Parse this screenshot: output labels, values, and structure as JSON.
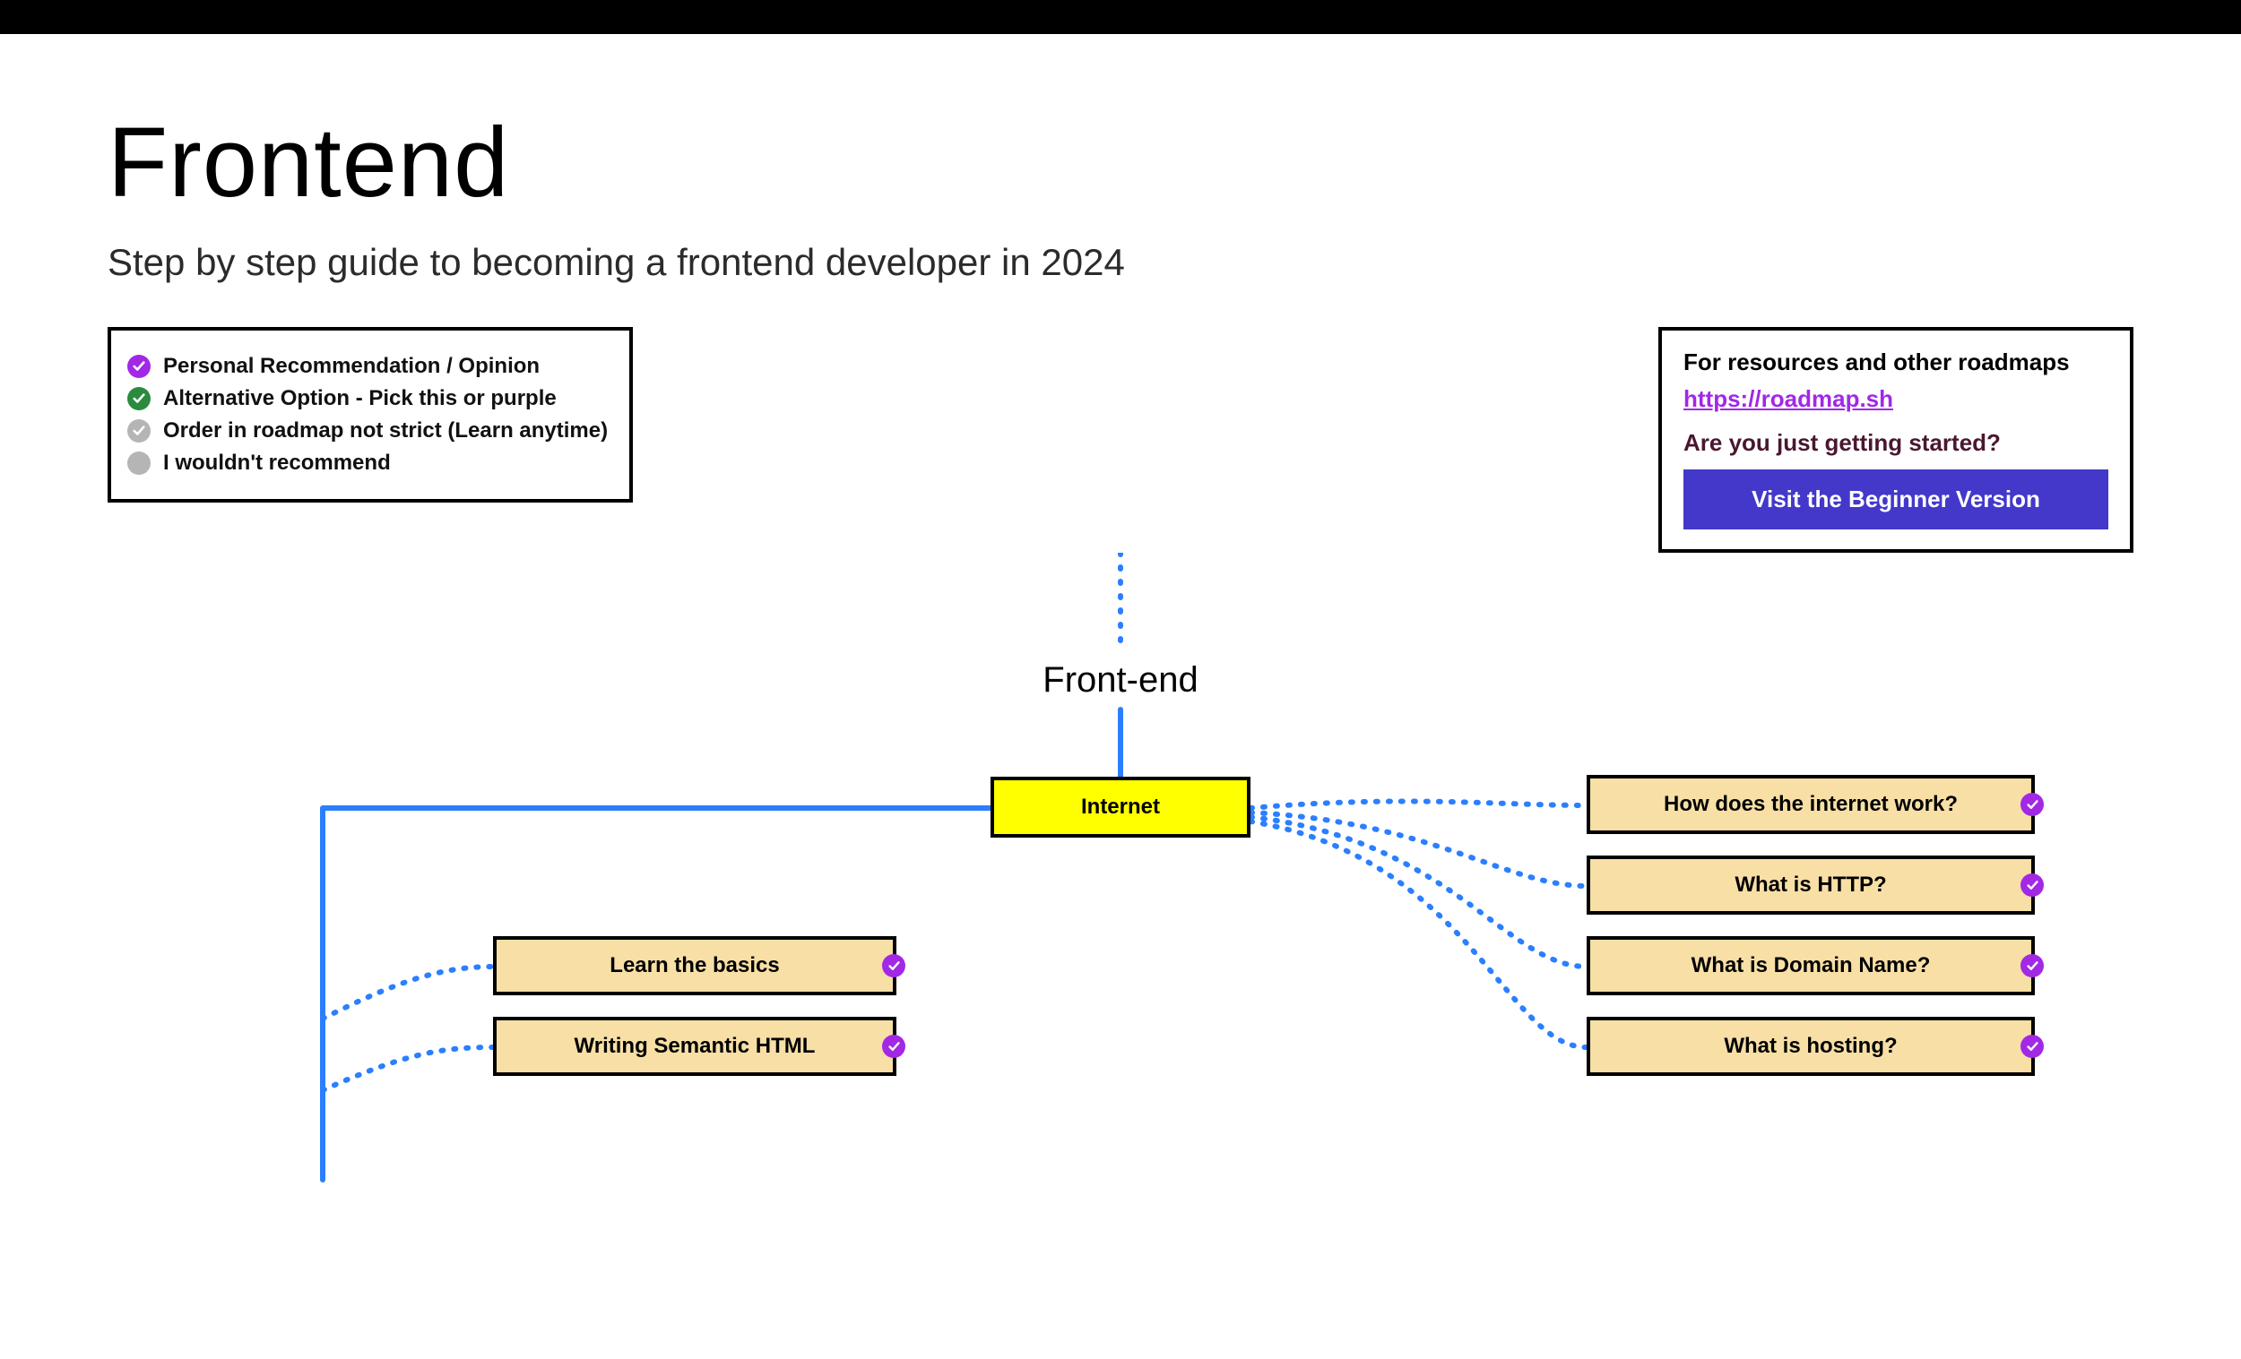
{
  "title": "Frontend",
  "subtitle": "Step by step guide to becoming a frontend developer in 2024",
  "legend": {
    "items": [
      {
        "color": "purple",
        "check": true,
        "label": "Personal Recommendation / Opinion"
      },
      {
        "color": "green",
        "check": true,
        "label": "Alternative Option - Pick this or purple"
      },
      {
        "color": "grey",
        "check": true,
        "label": "Order in roadmap not strict (Learn anytime)"
      },
      {
        "color": "lgrey",
        "check": false,
        "label": "I wouldn't recommend"
      }
    ]
  },
  "resources": {
    "intro": "For resources and other roadmaps",
    "link": "https://roadmap.sh",
    "question": "Are you just getting started?",
    "button_label": "Visit the Beginner Version"
  },
  "roadmap": {
    "start_label": "Front-end",
    "root_node": "Internet",
    "right_children": [
      "How does the internet work?",
      "What is HTTP?",
      "What is Domain Name?",
      "What is hosting?"
    ],
    "left_children": [
      "Learn the basics",
      "Writing Semantic HTML"
    ]
  },
  "colors": {
    "accent_purple": "#a228e6",
    "accent_green": "#2b8a3e",
    "accent_grey": "#b5b5b5",
    "primary_button": "#4338ca",
    "node_yellow": "#ffff00",
    "node_tan": "#f7dfa6",
    "connector_blue": "#2b7fff"
  }
}
